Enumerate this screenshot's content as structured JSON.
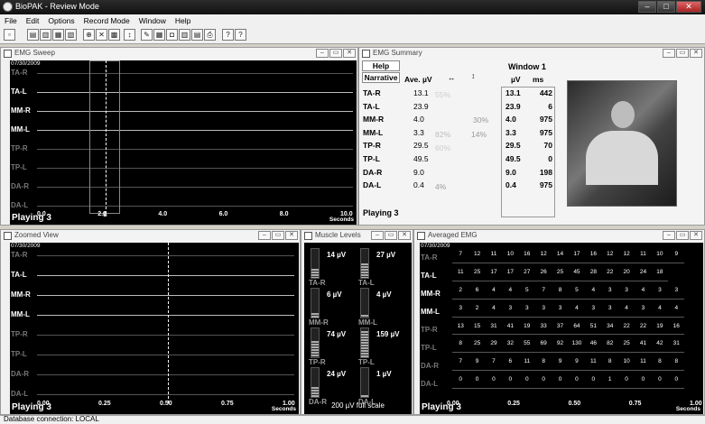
{
  "app": {
    "title": "BioPAK - Review Mode"
  },
  "menu": [
    "File",
    "Edit",
    "Options",
    "Record Mode",
    "Window",
    "Help"
  ],
  "sweep": {
    "title": "EMG Sweep",
    "date": "07/30/2009",
    "channels": [
      "TA-R",
      "TA-L",
      "MM-R",
      "MM-L",
      "TP-R",
      "TP-L",
      "DA-R",
      "DA-L"
    ],
    "ticks": [
      "0.0",
      "2.0",
      "4.0",
      "6.0",
      "8.0",
      "10.0"
    ],
    "tick_cursor": "S",
    "seconds": "Seconds",
    "playing": "Playing 3"
  },
  "summary": {
    "title": "EMG Summary",
    "help": "Help",
    "narrative": "Narrative",
    "col_ave": "Ave. µV",
    "window": "Window 1",
    "col_uv": "µV",
    "col_ms": "ms",
    "rows": [
      {
        "ch": "TA-R",
        "ave": "13.1",
        "uv": "13.1",
        "ms": "442"
      },
      {
        "ch": "TA-L",
        "ave": "23.9",
        "uv": "23.9",
        "ms": "6"
      },
      {
        "ch": "MM-R",
        "ave": "4.0",
        "uv": "4.0",
        "ms": "975"
      },
      {
        "ch": "MM-L",
        "ave": "3.3",
        "uv": "3.3",
        "ms": "975"
      },
      {
        "ch": "TP-R",
        "ave": "29.5",
        "uv": "29.5",
        "ms": "70"
      },
      {
        "ch": "TP-L",
        "ave": "49.5",
        "uv": "49.5",
        "ms": "0"
      },
      {
        "ch": "DA-R",
        "ave": "9.0",
        "uv": "9.0",
        "ms": "198"
      },
      {
        "ch": "DA-L",
        "ave": "0.4",
        "uv": "0.4",
        "ms": "975"
      }
    ],
    "pct": {
      "ta": "55%",
      "mm_lr": "82%",
      "mm_v": "30%",
      "mm_v2": "14%",
      "tp": "60%",
      "da": "4%"
    },
    "playing": "Playing 3"
  },
  "zoom": {
    "title": "Zoomed View",
    "date": "07/30/2009",
    "channels": [
      "TA-R",
      "TA-L",
      "MM-R",
      "MM-L",
      "TP-R",
      "TP-L",
      "DA-R",
      "DA-L"
    ],
    "ticks": [
      "0.00",
      "0.25",
      "0.50",
      "0.75",
      "1.00"
    ],
    "seconds": "Seconds",
    "playing": "Playing 3"
  },
  "levels": {
    "title": "Muscle Levels",
    "pairs": [
      {
        "lv": "14 µV",
        "rv": "27 µV",
        "ll": "TA-R",
        "rl": "TA-L",
        "lf": 0.3,
        "rf": 0.5
      },
      {
        "lv": "6 µV",
        "rv": "4 µV",
        "ll": "MM-R",
        "rl": "MM-L",
        "lf": 0.15,
        "rf": 0.1
      },
      {
        "lv": "74 µV",
        "rv": "159 µV",
        "ll": "TP-R",
        "rl": "TP-L",
        "lf": 0.55,
        "rf": 0.9
      },
      {
        "lv": "24 µV",
        "rv": "1 µV",
        "ll": "DA-R",
        "rl": "DA-L",
        "lf": 0.35,
        "rf": 0.05
      }
    ],
    "scale": "200 µV full scale"
  },
  "averaged": {
    "title": "Averaged EMG",
    "date": "07/30/2009",
    "channels": [
      "TA-R",
      "TA-L",
      "MM-R",
      "MM-L",
      "TP-R",
      "TP-L",
      "DA-R",
      "DA-L"
    ],
    "grid": [
      [
        "7",
        "12",
        "11",
        "10",
        "16",
        "12",
        "14",
        "17",
        "16",
        "12",
        "12",
        "11",
        "10",
        "9"
      ],
      [
        "11",
        "25",
        "17",
        "17",
        "27",
        "26",
        "25",
        "45",
        "28",
        "22",
        "20",
        "24",
        "18"
      ],
      [
        "2",
        "6",
        "4",
        "4",
        "5",
        "7",
        "8",
        "5",
        "4",
        "3",
        "3",
        "4",
        "3",
        "3"
      ],
      [
        "3",
        "2",
        "4",
        "3",
        "3",
        "3",
        "3",
        "4",
        "3",
        "3",
        "4",
        "3",
        "4",
        "4"
      ],
      [
        "13",
        "15",
        "31",
        "41",
        "19",
        "33",
        "37",
        "64",
        "51",
        "34",
        "22",
        "22",
        "19",
        "16"
      ],
      [
        "8",
        "25",
        "29",
        "32",
        "55",
        "69",
        "92",
        "130",
        "46",
        "82",
        "25",
        "41",
        "42",
        "31"
      ],
      [
        "7",
        "9",
        "7",
        "6",
        "11",
        "8",
        "9",
        "9",
        "11",
        "8",
        "10",
        "11",
        "8",
        "8"
      ],
      [
        "0",
        "0",
        "0",
        "0",
        "0",
        "0",
        "0",
        "0",
        "0",
        "1",
        "0",
        "0",
        "0",
        "0"
      ]
    ],
    "ticks": [
      "0.00",
      "0.25",
      "0.50",
      "0.75",
      "1.00"
    ],
    "seconds": "Seconds",
    "playing": "Playing 3"
  },
  "status": {
    "text": "Database connection: LOCAL"
  }
}
